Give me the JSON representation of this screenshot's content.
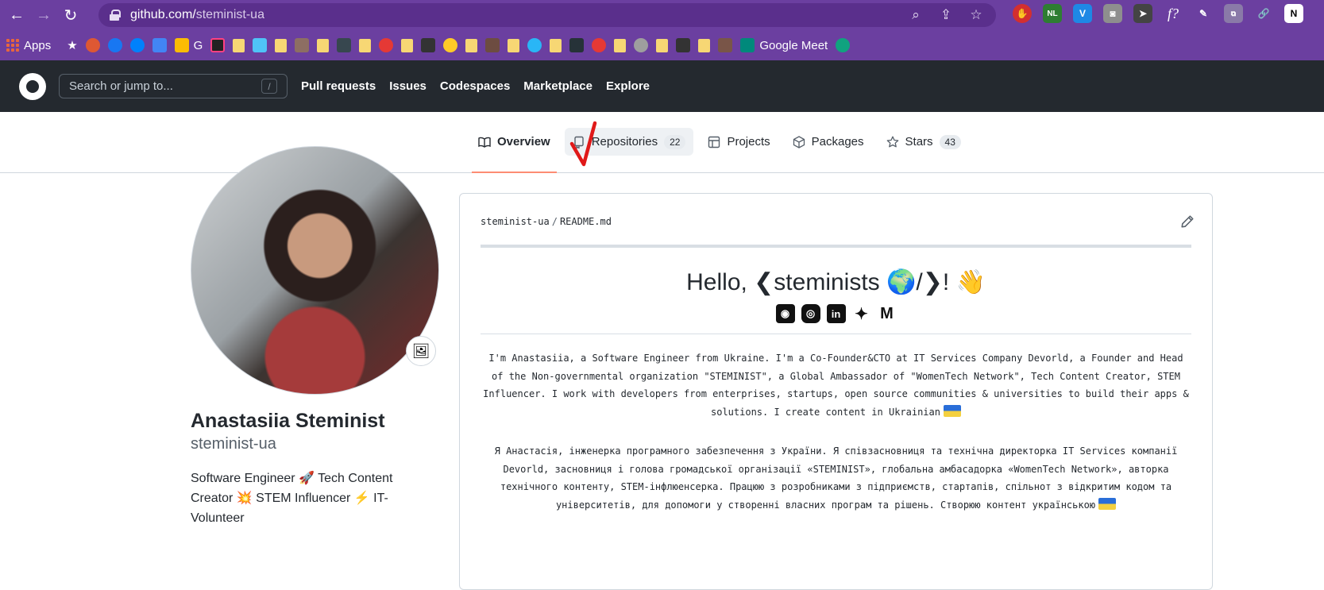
{
  "browser": {
    "url_host": "github.com/",
    "url_path": "steminist-ua",
    "bookmarks": {
      "apps_label": "Apps",
      "g_label": "G",
      "google_meet_label": "Google Meet"
    },
    "extensions": [
      "NL",
      "V",
      "f?"
    ]
  },
  "github": {
    "search_placeholder": "Search or jump to...",
    "search_shortcut": "/",
    "nav": [
      "Pull requests",
      "Issues",
      "Codespaces",
      "Marketplace",
      "Explore"
    ]
  },
  "tabs": [
    {
      "label": "Overview",
      "count": null
    },
    {
      "label": "Repositories",
      "count": "22"
    },
    {
      "label": "Projects",
      "count": null
    },
    {
      "label": "Packages",
      "count": null
    },
    {
      "label": "Stars",
      "count": "43"
    }
  ],
  "profile": {
    "name": "Anastasiia Steminist",
    "username": "steminist-ua",
    "bio": "Software Engineer 🚀 Tech Content Creator 💥 STEM Influencer ⚡ IT-Volunteer",
    "status_emoji": "🖼"
  },
  "readme": {
    "crumb_user": "steminist-ua",
    "crumb_sep": "/",
    "crumb_file": "README.md",
    "title": "Hello, ❮steminists 🌍/❯! 👋",
    "socials": [
      "discord",
      "instagram",
      "linkedin",
      "twitter",
      "gmail"
    ],
    "social_glyphs": [
      "◉",
      "◎",
      "in",
      "✦",
      "M"
    ],
    "para_en": "I'm Anastasiia, a Software Engineer from Ukraine. I'm a Co-Founder&CTO at IT Services Company Devorld, a Founder and Head of the Non-governmental organization \"STEMINIST\", a Global Ambassador of \"WomenTech Network\", Tech Content Creator, STEM Influencer. I work with developers from enterprises, startups, open source communities & universities to build their apps & solutions. I create content in Ukrainian",
    "para_ua": "Я Анастасія, інженерка програмного забезпечення з України. Я співзасновниця та технічна директорка IT Services компанії Devorld, засновниця і голова громадської організації «STEMINIST», глобальна амбасадорка «WomenTech Network», авторка технічного контенту, STEM-інфлюенсерка. Працюю з розробниками з підприємств, стартапів, спільнот з відкритим кодом та університетів, для допомоги у створенні власних програм та рішень. Створюю контент українською"
  }
}
